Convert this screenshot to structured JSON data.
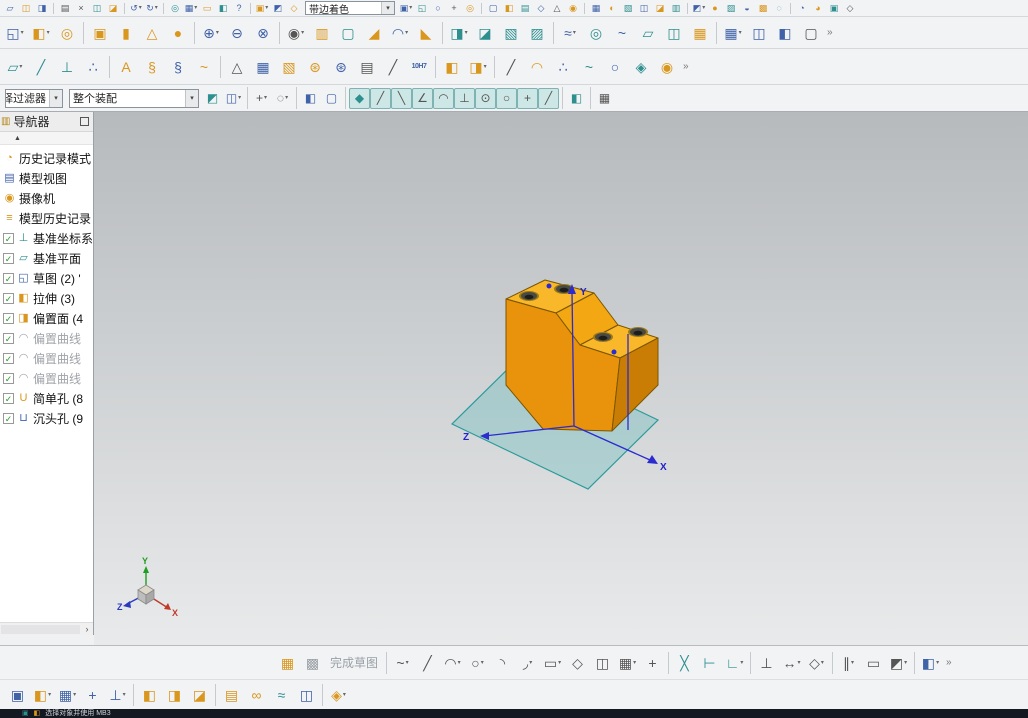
{
  "panel": {
    "title": "导航器",
    "collapse_glyph": "▲",
    "scroll_right_glyph": "›"
  },
  "statusbar": {
    "text": "选择对象并使用 MB3"
  },
  "viewport": {
    "axis_x": "X",
    "axis_y": "Y",
    "axis_z": "Z",
    "triad_x": "X",
    "triad_y": "Y",
    "triad_z": "Z"
  },
  "colors": {
    "model_light": "#f9b82a",
    "model_mid": "#e8930b",
    "model_dark": "#c97d05",
    "datum_plane": "#2a9a9a",
    "axis_blue": "#2b2bd0",
    "triad_x": "#c03a2a",
    "triad_y": "#1f9e1f",
    "triad_z": "#2a3ac0"
  },
  "toolbar_row1": [
    [
      "i",
      "new-file",
      "▱",
      "b"
    ],
    [
      "i",
      "open-file",
      "◫",
      "g"
    ],
    [
      "i",
      "save",
      "◨",
      "b"
    ],
    [
      "s"
    ],
    [
      "i",
      "print",
      "▤",
      "k"
    ],
    [
      "i",
      "cut",
      "×",
      "k"
    ],
    [
      "i",
      "copy",
      "◫",
      "t"
    ],
    [
      "i",
      "paste",
      "◪",
      "g"
    ],
    [
      "s"
    ],
    [
      "i",
      "undo",
      "↺",
      "b",
      "d"
    ],
    [
      "i",
      "redo",
      "↻",
      "b",
      "d"
    ],
    [
      "s"
    ],
    [
      "i",
      "refresh",
      "◎",
      "t"
    ],
    [
      "i",
      "window-switch",
      "▦",
      "b",
      "d"
    ],
    [
      "i",
      "touch-mode",
      "▭",
      "g"
    ],
    [
      "i",
      "screen-capture",
      "◧",
      "t"
    ],
    [
      "i",
      "help",
      "?",
      "b"
    ],
    [
      "s"
    ],
    [
      "i",
      "start-module",
      "▣",
      "g",
      "d"
    ],
    [
      "i",
      "quick-tool-1",
      "◩",
      "b"
    ],
    [
      "i",
      "quick-tool-2",
      "◇",
      "g"
    ],
    [
      "c",
      "render-style-combo",
      "带边着色",
      90,
      "left"
    ],
    [
      "i",
      "view-tool-1",
      "▣",
      "b",
      "d"
    ],
    [
      "i",
      "view-tool-2",
      "◱",
      "t"
    ],
    [
      "i",
      "view-tool-3",
      "○",
      "b"
    ],
    [
      "i",
      "view-tool-4",
      "+",
      "k"
    ],
    [
      "i",
      "view-tool-5",
      "◎",
      "g"
    ],
    [
      "s"
    ],
    [
      "i",
      "view-tool-6",
      "▢",
      "b"
    ],
    [
      "i",
      "view-tool-7",
      "◧",
      "g"
    ],
    [
      "i",
      "view-tool-8",
      "▤",
      "t"
    ],
    [
      "i",
      "view-tool-9",
      "◇",
      "b"
    ],
    [
      "i",
      "view-tool-10",
      "△",
      "k"
    ],
    [
      "i",
      "view-tool-11",
      "◉",
      "g"
    ],
    [
      "s"
    ],
    [
      "i",
      "view-tool-12",
      "▦",
      "b"
    ],
    [
      "i",
      "view-tool-13",
      "◐",
      "g"
    ],
    [
      "i",
      "view-tool-14",
      "▧",
      "t"
    ],
    [
      "i",
      "view-tool-15",
      "◫",
      "b"
    ],
    [
      "i",
      "view-tool-16",
      "◪",
      "g"
    ],
    [
      "i",
      "view-tool-17",
      "▥",
      "t"
    ],
    [
      "s"
    ],
    [
      "i",
      "view-tool-18",
      "◩",
      "b",
      "d"
    ],
    [
      "i",
      "view-tool-19",
      "●",
      "g"
    ],
    [
      "i",
      "view-tool-20",
      "▨",
      "t"
    ],
    [
      "i",
      "view-tool-21",
      "◒",
      "b"
    ],
    [
      "i",
      "view-tool-22",
      "▩",
      "g"
    ],
    [
      "i",
      "view-tool-23",
      "◌",
      "t"
    ],
    [
      "s"
    ],
    [
      "i",
      "view-tool-24",
      "◔",
      "b"
    ],
    [
      "i",
      "view-tool-25",
      "◕",
      "g"
    ],
    [
      "i",
      "view-tool-26",
      "▣",
      "t"
    ],
    [
      "i",
      "view-tool-27",
      "◇",
      "k"
    ]
  ],
  "toolbar_row2": [
    [
      "i",
      "sketch",
      "◱",
      "b",
      "d"
    ],
    [
      "i",
      "extrude",
      "◧",
      "g",
      "d"
    ],
    [
      "i",
      "revolve",
      "◎",
      "g"
    ],
    [
      "s"
    ],
    [
      "i",
      "block",
      "▣",
      "g"
    ],
    [
      "i",
      "cylinder",
      "▮",
      "g"
    ],
    [
      "i",
      "cone",
      "△",
      "g"
    ],
    [
      "i",
      "sphere",
      "●",
      "g"
    ],
    [
      "s"
    ],
    [
      "i",
      "unite",
      "⊕",
      "b",
      "d"
    ],
    [
      "i",
      "subtract",
      "⊖",
      "b"
    ],
    [
      "i",
      "intersect",
      "⊗",
      "b"
    ],
    [
      "s"
    ],
    [
      "i",
      "hole",
      "◉",
      "k",
      "d"
    ],
    [
      "i",
      "rib",
      "▥",
      "g"
    ],
    [
      "i",
      "shell",
      "▢",
      "t"
    ],
    [
      "i",
      "draft",
      "◢",
      "g"
    ],
    [
      "i",
      "edge-blend",
      "◠",
      "b",
      "d"
    ],
    [
      "i",
      "chamfer",
      "◣",
      "g"
    ],
    [
      "s"
    ],
    [
      "i",
      "trim-body",
      "◨",
      "t",
      "d"
    ],
    [
      "i",
      "split-body",
      "◪",
      "t"
    ],
    [
      "i",
      "patch",
      "▧",
      "t"
    ],
    [
      "i",
      "sew",
      "▨",
      "t"
    ],
    [
      "s"
    ],
    [
      "i",
      "swept",
      "≈",
      "b",
      "d"
    ],
    [
      "i",
      "tube",
      "◎",
      "t"
    ],
    [
      "i",
      "through-curves",
      "~",
      "b"
    ],
    [
      "i",
      "ruled",
      "▱",
      "t"
    ],
    [
      "i",
      "offset-surface",
      "◫",
      "t"
    ],
    [
      "i",
      "thicken",
      "▦",
      "g"
    ],
    [
      "s"
    ],
    [
      "i",
      "pattern-feature",
      "▦",
      "b",
      "d"
    ],
    [
      "i",
      "mirror-feature",
      "◫",
      "b"
    ],
    [
      "i",
      "move-face",
      "◧",
      "b"
    ],
    [
      "i",
      "delete-face",
      "▢",
      "k"
    ],
    [
      "o"
    ]
  ],
  "toolbar_row3": [
    [
      "i",
      "datum-plane",
      "▱",
      "t",
      "d"
    ],
    [
      "i",
      "datum-axis",
      "╱",
      "t"
    ],
    [
      "i",
      "datum-csys",
      "⊥",
      "t"
    ],
    [
      "i",
      "point-tool",
      "∴",
      "b"
    ],
    [
      "s"
    ],
    [
      "i",
      "text-tool",
      "A",
      "g"
    ],
    [
      "i",
      "helix",
      "§",
      "g"
    ],
    [
      "i",
      "spring-tool",
      "§",
      "b"
    ],
    [
      "i",
      "law-curve",
      "~",
      "g"
    ],
    [
      "s"
    ],
    [
      "i",
      "triangle-tool",
      "△",
      "k"
    ],
    [
      "i",
      "lattice-tool",
      "▦",
      "b"
    ],
    [
      "i",
      "hatch-tool",
      "▧",
      "g"
    ],
    [
      "i",
      "gear-tool",
      "⊛",
      "g"
    ],
    [
      "i",
      "gear-pair-tool",
      "⊛",
      "b"
    ],
    [
      "i",
      "sheet-list",
      "▤",
      "k"
    ],
    [
      "i",
      "slope-tool",
      "╱",
      "k"
    ],
    [
      "i",
      "tolerance-10H7",
      "10H7",
      "b"
    ],
    [
      "s"
    ],
    [
      "i",
      "feature-cube-1",
      "◧",
      "g"
    ],
    [
      "i",
      "feature-cube-2",
      "◨",
      "g",
      "d"
    ],
    [
      "s"
    ],
    [
      "i",
      "line-tool",
      "╱",
      "k"
    ],
    [
      "i",
      "arc-tool",
      "◠",
      "g"
    ],
    [
      "i",
      "point-tool-2",
      "∴",
      "b"
    ],
    [
      "i",
      "spline-tool",
      "~",
      "t"
    ],
    [
      "i",
      "circle-tool",
      "○",
      "b"
    ],
    [
      "i",
      "surface-tool",
      "◈",
      "t"
    ],
    [
      "i",
      "freeform-tool",
      "◉",
      "g"
    ],
    [
      "o"
    ]
  ],
  "toolbar_row4": [
    [
      "c",
      "selection-filter-combo",
      "无选择过滤器",
      58,
      "right"
    ],
    [
      "c",
      "selection-scope-combo",
      "整个装配",
      130,
      "left"
    ],
    [
      "i",
      "filter-tool-1",
      "◩",
      "t"
    ],
    [
      "i",
      "filter-tool-2",
      "◫",
      "b",
      "d"
    ],
    [
      "s"
    ],
    [
      "i",
      "select-add",
      "+",
      "k",
      "d"
    ],
    [
      "i",
      "select-lasso",
      "◌",
      "k",
      "d"
    ],
    [
      "s"
    ],
    [
      "i",
      "show-shaded",
      "◧",
      "b"
    ],
    [
      "i",
      "show-wire",
      "▢",
      "b"
    ],
    [
      "s"
    ],
    [
      "i",
      "snap-enable",
      "◆",
      "t",
      "a"
    ],
    [
      "i",
      "snap-endpoint",
      "╱",
      "k",
      "a"
    ],
    [
      "i",
      "snap-midpoint",
      "╲",
      "k",
      "a"
    ],
    [
      "i",
      "snap-angle",
      "∠",
      "k",
      "a"
    ],
    [
      "i",
      "snap-arc",
      "◠",
      "k",
      "a"
    ],
    [
      "i",
      "snap-perp",
      "⊥",
      "k",
      "a"
    ],
    [
      "i",
      "snap-center",
      "⊙",
      "k",
      "a"
    ],
    [
      "i",
      "snap-circle",
      "○",
      "k",
      "a"
    ],
    [
      "i",
      "snap-intersection",
      "+",
      "k",
      "a"
    ],
    [
      "i",
      "snap-tangent",
      "╱",
      "k",
      "a"
    ],
    [
      "s"
    ],
    [
      "i",
      "work-plane",
      "◧",
      "t"
    ],
    [
      "s"
    ],
    [
      "i",
      "grid-display",
      "▦",
      "k"
    ]
  ],
  "bottom_row1": [
    [
      "i",
      "sketch-env",
      "▦",
      "g"
    ],
    [
      "i",
      "finish-sketch",
      "▩",
      "gray"
    ],
    [
      "l",
      "finish-sketch-label",
      "完成草图"
    ],
    [
      "s"
    ],
    [
      "i",
      "profile",
      "~",
      "k",
      "d"
    ],
    [
      "i",
      "line",
      "╱",
      "k"
    ],
    [
      "i",
      "arc",
      "◠",
      "k",
      "d"
    ],
    [
      "i",
      "circle",
      "○",
      "k",
      "d"
    ],
    [
      "i",
      "corner-arc",
      "◝",
      "k"
    ],
    [
      "i",
      "fillet",
      "◞",
      "k",
      "d"
    ],
    [
      "i",
      "rectangle",
      "▭",
      "k",
      "d"
    ],
    [
      "i",
      "polygon",
      "◇",
      "k"
    ],
    [
      "i",
      "offset-curve",
      "◫",
      "k"
    ],
    [
      "i",
      "pattern-curve",
      "▦",
      "k",
      "d"
    ],
    [
      "i",
      "point",
      "+",
      "k"
    ],
    [
      "s"
    ],
    [
      "i",
      "quick-trim",
      "╳",
      "t"
    ],
    [
      "i",
      "quick-extend",
      "⊢",
      "t"
    ],
    [
      "i",
      "make-corner",
      "∟",
      "t",
      "d"
    ],
    [
      "s"
    ],
    [
      "i",
      "geometric-constraints",
      "⊥",
      "k"
    ],
    [
      "i",
      "rapid-dimension",
      "↔",
      "k",
      "d"
    ],
    [
      "i",
      "auto-dimension",
      "◇",
      "k",
      "d"
    ],
    [
      "s"
    ],
    [
      "i",
      "display-constraints",
      "∥",
      "k",
      "d"
    ],
    [
      "i",
      "constraint-browser",
      "▭",
      "k"
    ],
    [
      "i",
      "relations-tool",
      "◩",
      "k",
      "d"
    ],
    [
      "s"
    ],
    [
      "i",
      "orient-sketch",
      "◧",
      "b",
      "d"
    ],
    [
      "o"
    ]
  ],
  "bottom_row2": [
    [
      "i",
      "assembly-window",
      "▣",
      "b"
    ],
    [
      "i",
      "add-component",
      "◧",
      "g",
      "d"
    ],
    [
      "i",
      "component-pattern",
      "▦",
      "b",
      "d"
    ],
    [
      "i",
      "move-component",
      "+",
      "b"
    ],
    [
      "i",
      "assembly-constraints",
      "⊥",
      "b",
      "d"
    ],
    [
      "s"
    ],
    [
      "i",
      "component-gold-1",
      "◧",
      "g"
    ],
    [
      "i",
      "component-gold-2",
      "◨",
      "g"
    ],
    [
      "i",
      "component-gold-3",
      "◪",
      "g"
    ],
    [
      "s"
    ],
    [
      "i",
      "sequence-tool",
      "▤",
      "g"
    ],
    [
      "i",
      "wave-link",
      "∞",
      "g"
    ],
    [
      "i",
      "interpart-tool",
      "≈",
      "t"
    ],
    [
      "i",
      "reference-set",
      "◫",
      "b"
    ],
    [
      "s"
    ],
    [
      "i",
      "exploded-view",
      "◈",
      "g",
      "d"
    ]
  ],
  "navigator": {
    "items": [
      {
        "key": "history-mode",
        "g": "◔",
        "c": "g",
        "label": "历史记录模式",
        "check": null,
        "muted": false
      },
      {
        "key": "model-views",
        "g": "▤",
        "c": "b",
        "label": "模型视图",
        "check": null,
        "muted": false
      },
      {
        "key": "cameras",
        "g": "◉",
        "c": "g",
        "label": "摄像机",
        "check": null,
        "muted": false
      },
      {
        "key": "model-history",
        "g": "≡",
        "c": "g",
        "label": "模型历史记录",
        "check": null,
        "muted": false
      },
      {
        "key": "datum-csys",
        "g": "⊥",
        "c": "t",
        "label": "基准坐标系",
        "check": true,
        "muted": false
      },
      {
        "key": "datum-plane",
        "g": "▱",
        "c": "t",
        "label": "基准平面",
        "check": true,
        "muted": false
      },
      {
        "key": "sketch-2",
        "g": "◱",
        "c": "b",
        "label": "草图 (2) '",
        "check": true,
        "muted": false
      },
      {
        "key": "extrude-3",
        "g": "◧",
        "c": "g",
        "label": "拉伸 (3)",
        "check": true,
        "muted": false
      },
      {
        "key": "offset-face-4",
        "g": "◨",
        "c": "g",
        "label": "偏置面 (4",
        "check": true,
        "muted": false
      },
      {
        "key": "offset-curve-1",
        "g": "◠",
        "c": "gray",
        "label": "偏置曲线",
        "check": true,
        "muted": true
      },
      {
        "key": "offset-curve-2",
        "g": "◠",
        "c": "gray",
        "label": "偏置曲线",
        "check": true,
        "muted": true
      },
      {
        "key": "offset-curve-3",
        "g": "◠",
        "c": "gray",
        "label": "偏置曲线",
        "check": true,
        "muted": true
      },
      {
        "key": "simple-hole-8",
        "g": "U",
        "c": "g",
        "label": "简单孔 (8",
        "check": true,
        "muted": false
      },
      {
        "key": "counterbore-hole-9",
        "g": "⊔",
        "c": "b",
        "label": "沉头孔 (9",
        "check": true,
        "muted": false
      }
    ]
  }
}
